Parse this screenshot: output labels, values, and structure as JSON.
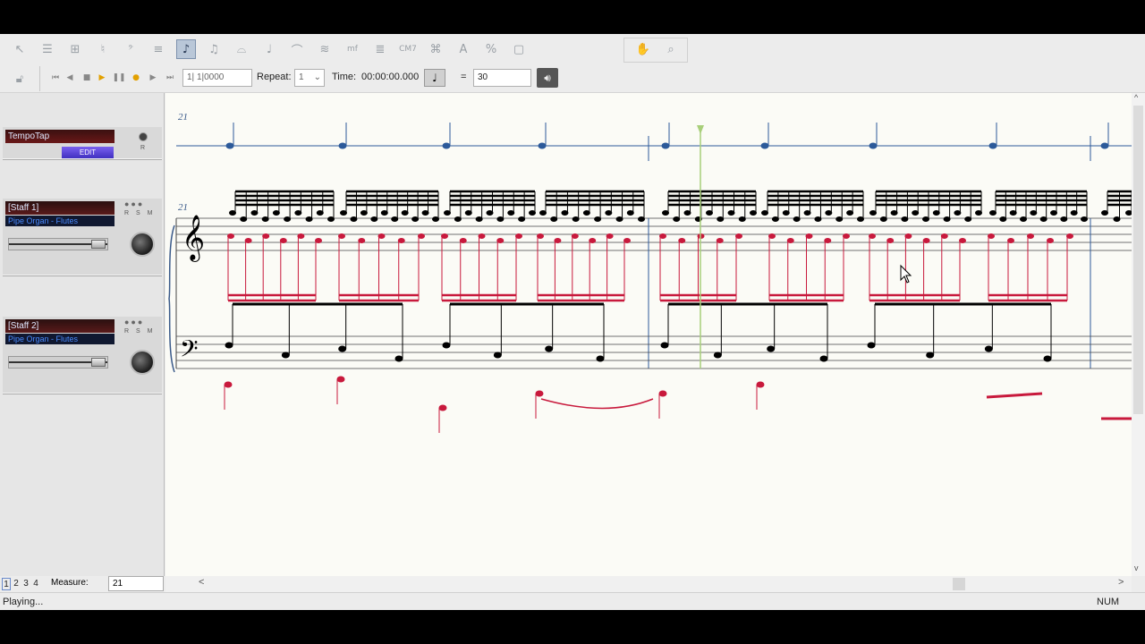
{
  "toolbar": {
    "tools": [
      {
        "name": "select-tool-icon",
        "glyph": "↖"
      },
      {
        "name": "staff-tool-icon",
        "glyph": "☰"
      },
      {
        "name": "measure-tool-icon",
        "glyph": "⊞"
      },
      {
        "name": "key-sig-tool-icon",
        "glyph": "♮"
      },
      {
        "name": "clef-tool-icon",
        "glyph": "𝄢"
      },
      {
        "name": "time-sig-tool-icon",
        "glyph": "≡"
      },
      {
        "name": "simple-entry-tool-icon",
        "glyph": "♪",
        "active": true
      },
      {
        "name": "speedy-entry-tool-icon",
        "glyph": "♫"
      },
      {
        "name": "tuplet-tool-icon",
        "glyph": "⌓"
      },
      {
        "name": "articulation-tool-icon",
        "glyph": "♩"
      },
      {
        "name": "smart-shape-tool-icon",
        "glyph": "⌒"
      },
      {
        "name": "repeat-tool-icon",
        "glyph": "≋"
      },
      {
        "name": "expression-tool-icon",
        "glyph": "mf"
      },
      {
        "name": "lyrics-tool-icon",
        "glyph": "≣"
      },
      {
        "name": "chord-tool-icon",
        "glyph": "CM7"
      },
      {
        "name": "ossia-tool-icon",
        "glyph": "⌘"
      },
      {
        "name": "text-tool-icon",
        "glyph": "A"
      },
      {
        "name": "resize-tool-icon",
        "glyph": "%"
      },
      {
        "name": "page-layout-tool-icon",
        "glyph": "▢"
      }
    ],
    "right_tools": [
      {
        "name": "hand-grabber-icon",
        "glyph": "✋"
      },
      {
        "name": "zoom-tool-icon",
        "glyph": "⌕"
      }
    ]
  },
  "playback": {
    "position": "1| 1|0000",
    "repeat_label": "Repeat:",
    "repeat_value": "1",
    "time_label": "Time:",
    "time_value": "00:00:00.000",
    "tempo_equals": "=",
    "tempo_value": "30"
  },
  "tracks": [
    {
      "name": "TempoTap",
      "edit_label": "EDIT",
      "r_label": "R"
    },
    {
      "name": "[Staff 1]",
      "instrument": "Pipe Organ - Flutes",
      "rsm": "R S M"
    },
    {
      "name": "[Staff 2]",
      "instrument": "Pipe Organ - Flutes",
      "rsm": "R S M"
    }
  ],
  "score": {
    "tempo_measure_number": "21",
    "staff_measure_number": "21",
    "colors": {
      "tempo_line": "#2c5a9a",
      "black_notes": "#000000",
      "red_notes": "#c8193c",
      "playback_line": "#a8cf7a"
    }
  },
  "pages": [
    "1",
    "2",
    "3",
    "4"
  ],
  "measure": {
    "label": "Measure:",
    "value": "21"
  },
  "hscroll": {
    "left": "<",
    "right": ">"
  },
  "vscroll": {
    "up": "^",
    "down": "v"
  },
  "status": {
    "text": "Playing...",
    "num": "NUM"
  }
}
